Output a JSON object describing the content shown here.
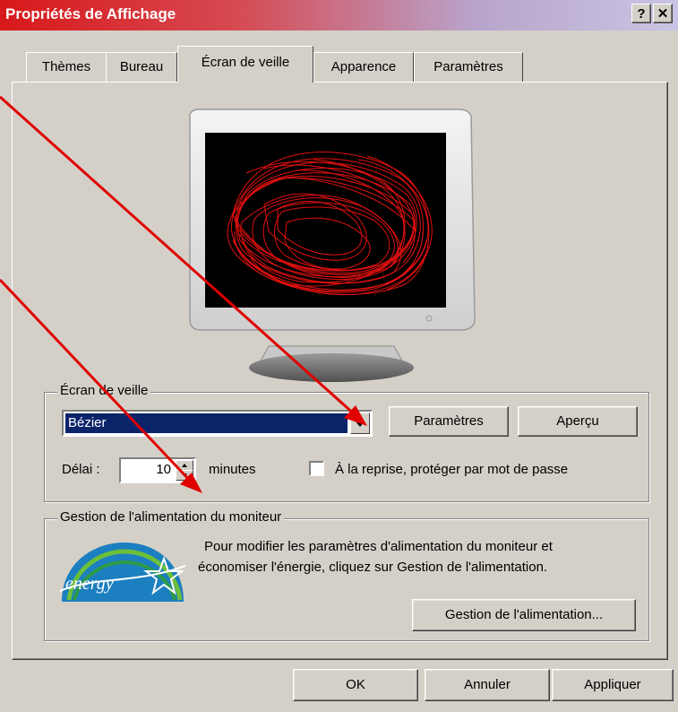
{
  "window": {
    "title": "Propriétés de Affichage",
    "help_label": "?",
    "close_label": "✕"
  },
  "tabs": [
    {
      "label": "Thèmes"
    },
    {
      "label": "Bureau"
    },
    {
      "label": "Écran de veille",
      "active": true
    },
    {
      "label": "Apparence"
    },
    {
      "label": "Paramètres"
    }
  ],
  "screensaver": {
    "group_label": "Écran de veille",
    "selected": "Bézier",
    "settings_button": "Paramètres",
    "preview_button": "Aperçu",
    "delay_label": "Délai :",
    "delay_value": "10",
    "minutes_label": "minutes",
    "password_label": "À la reprise, protéger par mot de passe",
    "password_checked": false
  },
  "power": {
    "group_label": "Gestion de l'alimentation du moniteur",
    "description_line1": "Pour modifier les paramètres d'alimentation du moniteur et",
    "description_line2": "économiser l'énergie, cliquez sur Gestion de l'alimentation.",
    "button": "Gestion de l'alimentation...",
    "logo_text": "energy"
  },
  "footer": {
    "ok": "OK",
    "cancel": "Annuler",
    "apply": "Appliquer"
  },
  "colors": {
    "selection": "#0a246a",
    "annotation_arrow": "#e00000",
    "preview_curve": "#e01010"
  }
}
